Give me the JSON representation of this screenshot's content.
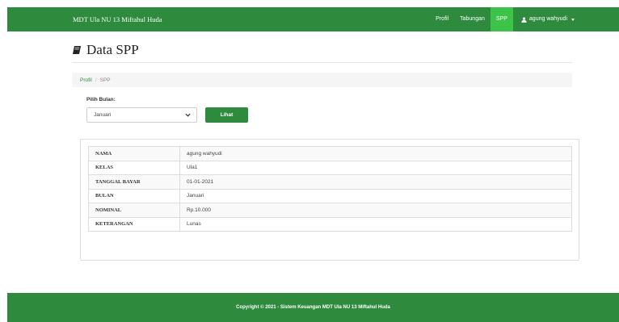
{
  "navbar": {
    "brand": "MDT Ula NU 13 Miftahul Huda",
    "links": [
      {
        "label": "Profil"
      },
      {
        "label": "Tabungan"
      },
      {
        "label": "SPP"
      }
    ],
    "active_link": "SPP",
    "user": {
      "name": "agung wahyudi",
      "icon": "user-icon"
    }
  },
  "page": {
    "title": "Data SPP",
    "title_icon": "book-icon"
  },
  "breadcrumb": {
    "link": "Profil",
    "separator": "/",
    "current": "SPP"
  },
  "filter": {
    "label": "Pilih Bulan:",
    "selected_month": "Januari",
    "button_label": "Lihat"
  },
  "details": {
    "rows": [
      {
        "key": "NAMA",
        "value": "agung wahyudi"
      },
      {
        "key": "KELAS",
        "value": "Ula1"
      },
      {
        "key": "TANGGAL BAYAR",
        "value": "01-01-2021"
      },
      {
        "key": "BULAN",
        "value": "Januari"
      },
      {
        "key": "NOMINAL",
        "value": "Rp.10.000"
      },
      {
        "key": "KETERANGAN",
        "value": "Lunas"
      }
    ]
  },
  "footer": {
    "text": "Copyright © 2021 - Sistem Keuangan MDT Ula NU 13 Miftahul Huda"
  },
  "colors": {
    "nav_green": "#2e8b3d",
    "active_green": "#3cc448"
  }
}
